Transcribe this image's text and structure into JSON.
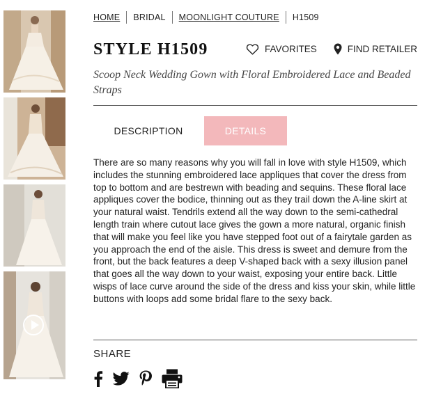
{
  "breadcrumb": {
    "items": [
      {
        "label": "HOME",
        "link": true
      },
      {
        "label": "BRIDAL",
        "link": false
      },
      {
        "label": "MOONLIGHT COUTURE",
        "link": true
      },
      {
        "label": "H1509",
        "link": false
      }
    ]
  },
  "product": {
    "title": "STYLE H1509",
    "subtitle": "Scoop Neck Wedding Gown with Floral Embroidered Lace and Beaded Straps"
  },
  "actions": {
    "favorites_label": "FAVORITES",
    "favorites_icon": "heart-icon",
    "retailer_label": "FIND RETAILER",
    "retailer_icon": "map-pin-icon"
  },
  "tabs": {
    "description_label": "DESCRIPTION",
    "details_label": "DETAILS",
    "active": "details",
    "active_color": "#f3b8bb"
  },
  "description": "There are so many reasons why you will fall in love with style H1509, which includes the stunning embroidered lace appliques that cover the dress from top to bottom and are bestrewn with beading and sequins. These floral lace appliques cover the bodice, thinning out as they trail down the A-line skirt at your natural waist. Tendrils extend all the way down to the semi-cathedral length train where cutout lace gives the gown a more natural, organic finish that will make you feel like you have stepped foot out of a fairytale garden as you approach the end of the aisle. This dress is sweet and demure from the front, but the back features a deep V-shaped back with a sexy illusion panel that goes all the way down to your waist, exposing your entire back. Little wisps of lace curve around the side of the dress and kiss your skin, while little buttons with loops add some bridal flare to the sexy back.",
  "share": {
    "label": "SHARE",
    "icons": [
      "facebook-icon",
      "twitter-icon",
      "pinterest-icon",
      "print-icon"
    ]
  },
  "thumbnails": {
    "count": 4,
    "video_thumbnail_index": 3,
    "icons": [
      "play-icon"
    ]
  }
}
